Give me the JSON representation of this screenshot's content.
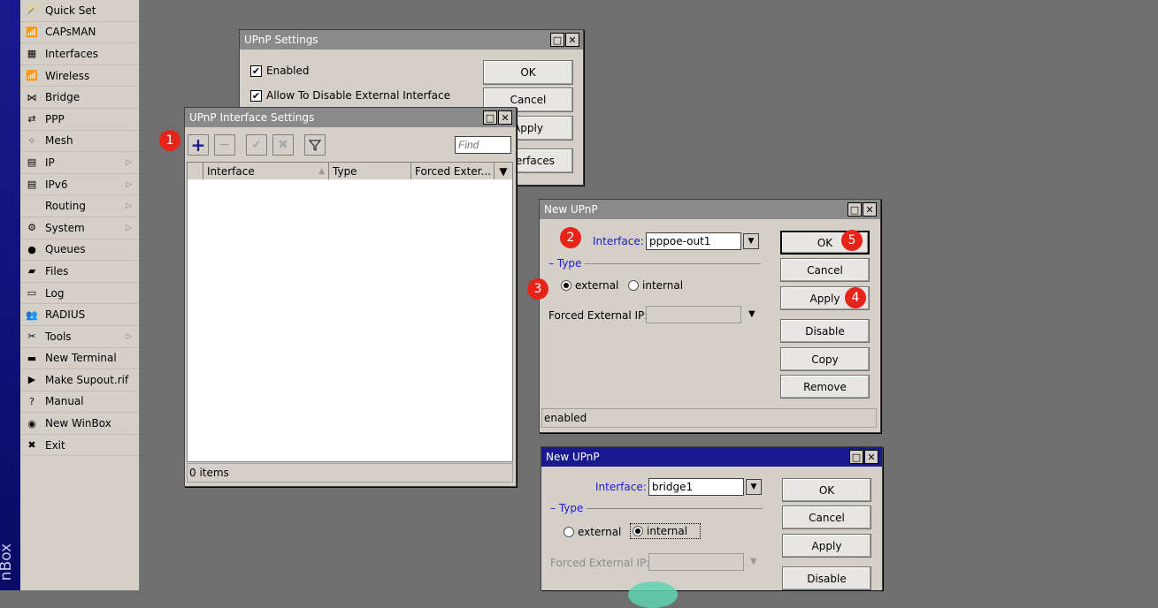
{
  "brand": "nBox",
  "menu": [
    {
      "label": "Quick Set",
      "icon": "wand-icon",
      "glyph": "🪄",
      "submenu": false
    },
    {
      "label": "CAPsMAN",
      "icon": "capsman-icon",
      "glyph": "📶",
      "submenu": false
    },
    {
      "label": "Interfaces",
      "icon": "interfaces-icon",
      "glyph": "▦",
      "submenu": false
    },
    {
      "label": "Wireless",
      "icon": "wireless-icon",
      "glyph": "📶",
      "submenu": false
    },
    {
      "label": "Bridge",
      "icon": "bridge-icon",
      "glyph": "⋈",
      "submenu": false
    },
    {
      "label": "PPP",
      "icon": "ppp-icon",
      "glyph": "⇄",
      "submenu": false
    },
    {
      "label": "Mesh",
      "icon": "mesh-icon",
      "glyph": "⁘",
      "submenu": false
    },
    {
      "label": "IP",
      "icon": "ip-icon",
      "glyph": "▤",
      "submenu": true
    },
    {
      "label": "IPv6",
      "icon": "ipv6-icon",
      "glyph": "▤",
      "submenu": true
    },
    {
      "label": "Routing",
      "icon": "routing-icon",
      "glyph": "",
      "submenu": true
    },
    {
      "label": "System",
      "icon": "gear-icon",
      "glyph": "⚙",
      "submenu": true
    },
    {
      "label": "Queues",
      "icon": "queues-icon",
      "glyph": "●",
      "submenu": false
    },
    {
      "label": "Files",
      "icon": "folder-icon",
      "glyph": "▰",
      "submenu": false
    },
    {
      "label": "Log",
      "icon": "log-icon",
      "glyph": "▭",
      "submenu": false
    },
    {
      "label": "RADIUS",
      "icon": "radius-icon",
      "glyph": "👥",
      "submenu": false
    },
    {
      "label": "Tools",
      "icon": "tools-icon",
      "glyph": "✂",
      "submenu": true
    },
    {
      "label": "New Terminal",
      "icon": "terminal-icon",
      "glyph": "▬",
      "submenu": false
    },
    {
      "label": "Make Supout.rif",
      "icon": "supout-icon",
      "glyph": "▶",
      "submenu": false
    },
    {
      "label": "Manual",
      "icon": "manual-icon",
      "glyph": "?",
      "submenu": false
    },
    {
      "label": "New WinBox",
      "icon": "winbox-icon",
      "glyph": "◉",
      "submenu": false
    },
    {
      "label": "Exit",
      "icon": "exit-icon",
      "glyph": "✖",
      "submenu": false
    }
  ],
  "upnp_settings": {
    "title": "UPnP Settings",
    "enabled_label": "Enabled",
    "allow_disable_label": "Allow To Disable External Interface",
    "ok": "OK",
    "cancel": "Cancel",
    "apply": "Apply",
    "interfaces": "Interfaces"
  },
  "upnp_iface": {
    "title": "UPnP Interface Settings",
    "find_placeholder": "Find",
    "columns": [
      "Interface",
      "Type",
      "Forced Exter..."
    ],
    "footer": "0 items"
  },
  "new_upnp_1": {
    "title": "New UPnP",
    "interface_label": "Interface:",
    "interface_value": "pppoe-out1",
    "type_legend": "Type",
    "external": "external",
    "internal": "internal",
    "forced_ip_label": "Forced External IP:",
    "buttons": [
      "OK",
      "Cancel",
      "Apply",
      "Disable",
      "Copy",
      "Remove"
    ],
    "status": "enabled"
  },
  "new_upnp_2": {
    "title": "New UPnP",
    "interface_label": "Interface:",
    "interface_value": "bridge1",
    "type_legend": "Type",
    "external": "external",
    "internal": "internal",
    "forced_ip_label": "Forced External IP:",
    "buttons": [
      "OK",
      "Cancel",
      "Apply",
      "Disable"
    ]
  },
  "markers": [
    "1",
    "2",
    "3",
    "4",
    "5"
  ],
  "colors": {
    "accent": "#1a1a8c",
    "marker": "#e8231a",
    "label_blue": "#1a1ad0"
  }
}
